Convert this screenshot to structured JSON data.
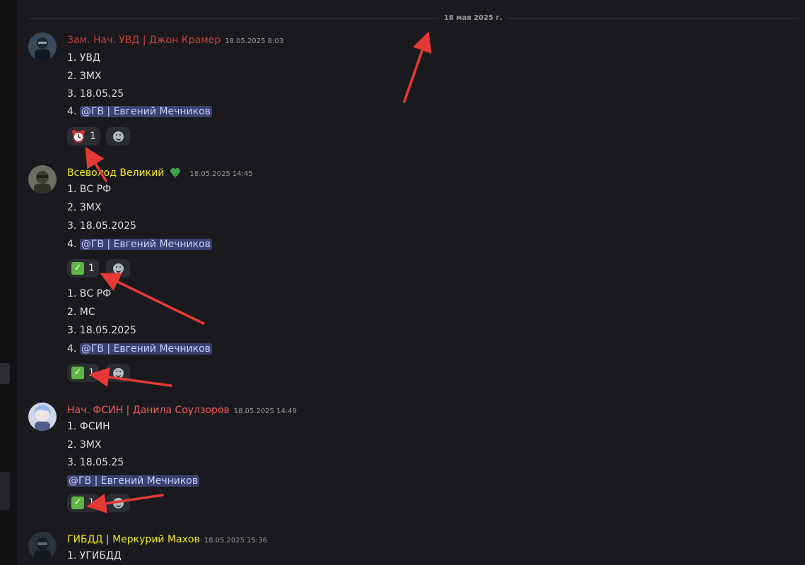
{
  "date_divider": "18 мая 2025 г.",
  "colors": {
    "background": "#1a1a1e",
    "name_red_dark": "#c93f3f",
    "name_yellow": "#f0e90c",
    "name_red": "#f05a5a",
    "mention_bg": "#3c4270",
    "mention_text": "#c9cdfb",
    "annotation_arrow": "#e53935"
  },
  "messages": [
    {
      "author": "Зам. Нач. УВД | Джон Крамер",
      "timestamp": "18.05.2025 8:03",
      "lines": [
        "1. УВД",
        "2. ЗМХ",
        "3. 18.05.25",
        "4. "
      ],
      "mention": "@ГВ | Евгений Мечников",
      "reaction": {
        "emoji": "alarm-clock",
        "count": "1"
      }
    },
    {
      "author": "Всеволод Великий",
      "author_badge": "clover-icon",
      "timestamp": "18.05.2025 14:45",
      "lines": [
        "1. ВС РФ",
        "2. ЗМХ",
        "3. 18.05.2025",
        "4. "
      ],
      "mention": "@ГВ | Евгений Мечников",
      "reaction": {
        "emoji": "check-mark",
        "count": "1"
      }
    },
    {
      "continuation": true,
      "lines": [
        "1. ВС РФ",
        "2. МС",
        "3. 18.05.2025",
        "4. "
      ],
      "mention": "@ГВ | Евгений Мечников",
      "reaction": {
        "emoji": "check-mark",
        "count": "1"
      }
    },
    {
      "author": "Нач. ФСИН | Данила Соулзоров",
      "timestamp": "18.05.2025 14:49",
      "lines": [
        "1. ФСИН",
        "2. ЗМХ",
        "3. 18.05.25"
      ],
      "mention": "@ГВ | Евгений Мечников",
      "reaction": {
        "emoji": "check-mark",
        "count": "1"
      }
    },
    {
      "author": "ГИБДД | Меркурий Махов",
      "timestamp": "18.05.2025 15:36",
      "lines": [
        "1. УГИБДД"
      ]
    }
  ]
}
